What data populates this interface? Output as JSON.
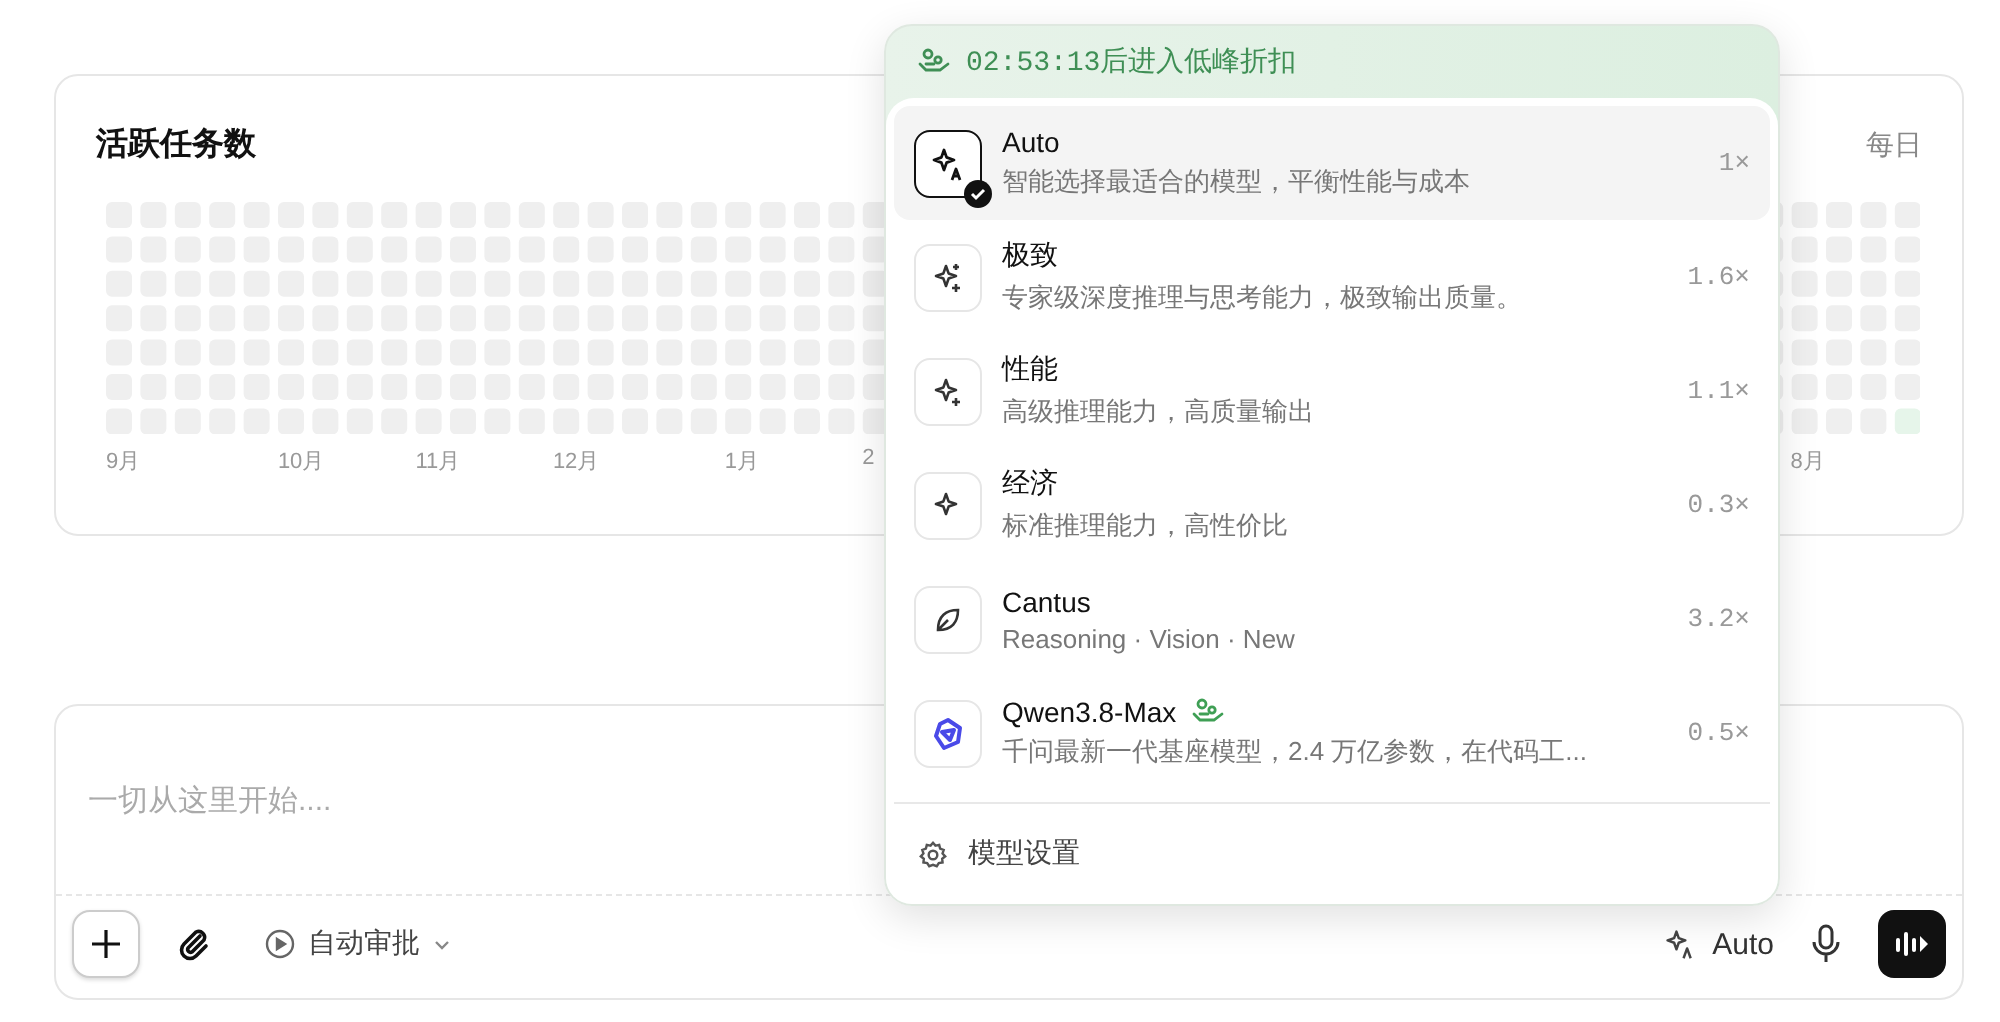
{
  "activity_card": {
    "title": "活跃任务数",
    "period": "每日",
    "months": [
      {
        "label": "9月"
      },
      {
        "label": "10月"
      },
      {
        "label": "11月"
      },
      {
        "label": "12月"
      },
      {
        "label": "1月"
      },
      {
        "label": "2"
      },
      {
        "label": "8月"
      }
    ]
  },
  "model_menu": {
    "banner": "02:53:13后进入低峰折扣",
    "models": [
      {
        "name": "Auto",
        "description": "智能选择最适合的模型，平衡性能与成本",
        "multiplier": "1×",
        "kind": "auto",
        "selected": true,
        "discount": false
      },
      {
        "name": "极致",
        "description": "专家级深度推理与思考能力，极致输出质量。",
        "multiplier": "1.6×",
        "kind": "spark3",
        "selected": false,
        "discount": false
      },
      {
        "name": "性能",
        "description": "高级推理能力，高质量输出",
        "multiplier": "1.1×",
        "kind": "spark2",
        "selected": false,
        "discount": false
      },
      {
        "name": "经济",
        "description": "标准推理能力，高性价比",
        "multiplier": "0.3×",
        "kind": "spark1",
        "selected": false,
        "discount": false
      },
      {
        "name": "Cantus",
        "description": "Reasoning · Vision · New",
        "multiplier": "3.2×",
        "kind": "leaf",
        "selected": false,
        "discount": false
      },
      {
        "name": "Qwen3.8-Max",
        "description": "千问最新一代基座模型，2.4 万亿参数，在代码工...",
        "multiplier": "0.5×",
        "kind": "qwen",
        "selected": false,
        "discount": true
      }
    ],
    "settings": "模型设置"
  },
  "composer": {
    "placeholder": "一切从这里开始....",
    "approval": "自动审批",
    "model": "Auto"
  }
}
